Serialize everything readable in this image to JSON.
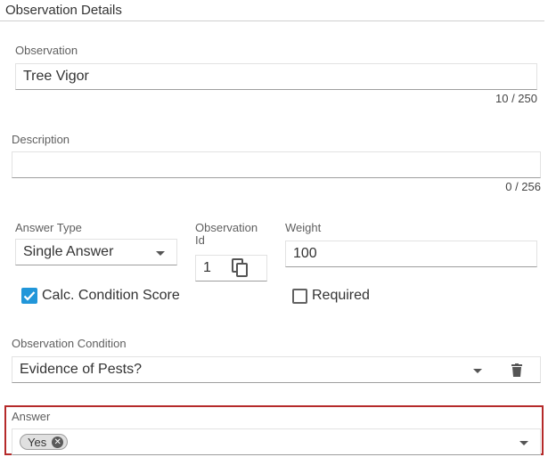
{
  "section": {
    "title": "Observation Details"
  },
  "observation": {
    "label": "Observation",
    "value": "Tree Vigor",
    "counter": "10 / 250"
  },
  "description": {
    "label": "Description",
    "value": "",
    "counter": "0 / 256"
  },
  "answer_type": {
    "label": "Answer Type",
    "value": "Single Answer",
    "icon": "caret-down-icon"
  },
  "observation_id": {
    "label_line1": "Observation",
    "label_line2": "Id",
    "value": "1",
    "icon": "copy-icon"
  },
  "weight": {
    "label": "Weight",
    "value": "100"
  },
  "calc_condition_score": {
    "label": "Calc. Condition Score",
    "checked": true
  },
  "required": {
    "label": "Required",
    "checked": false
  },
  "observation_condition": {
    "label": "Observation Condition",
    "value": "Evidence of Pests?",
    "icons": [
      "caret-down-icon",
      "trash-icon"
    ]
  },
  "answer": {
    "label": "Answer",
    "chips": [
      {
        "label": "Yes"
      }
    ],
    "icon": "caret-down-icon"
  },
  "colors": {
    "accent": "#2196d9",
    "highlight_border": "#b52a2a"
  }
}
